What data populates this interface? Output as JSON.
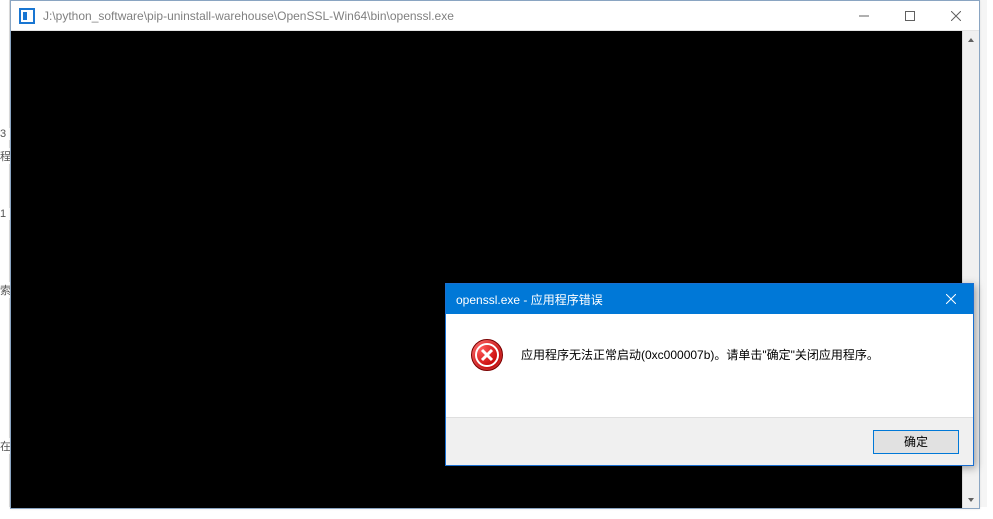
{
  "window": {
    "title_path": "J:\\python_software\\pip-uninstall-warehouse\\OpenSSL-Win64\\bin\\openssl.exe",
    "controls": {
      "minimize_icon": "minimize-icon",
      "maximize_icon": "maximize-icon",
      "close_icon": "close-icon"
    },
    "scrollbar": {
      "up_icon": "scroll-up-icon",
      "down_icon": "scroll-down-icon"
    }
  },
  "dialog": {
    "title": "openssl.exe - 应用程序错误",
    "message": "应用程序无法正常启动(0xc000007b)。请单击\"确定\"关闭应用程序。",
    "ok_label": "确定",
    "icon": "error-icon",
    "close_icon": "close-icon"
  },
  "gutter": {
    "f1": "3",
    "f2": "程",
    "f3": "1",
    "f4": "索",
    "f5": "在"
  }
}
